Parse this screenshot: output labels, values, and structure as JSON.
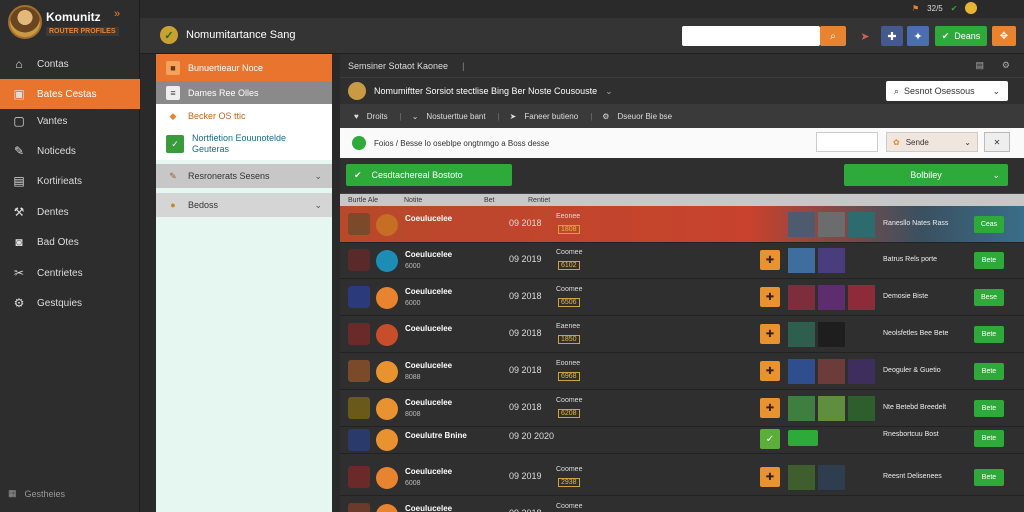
{
  "brand": {
    "name": "Komunitz",
    "sub": "ROUTER PROFILES",
    "mark": "»"
  },
  "top": {
    "title": "Nomumitartance Sang",
    "search_placeholder": "",
    "green_label": "Deans",
    "status": "32/5"
  },
  "nav": {
    "items": [
      {
        "label": "Contas",
        "icon": "home-icon"
      },
      {
        "label": "Bates Cestas",
        "icon": "folder-icon"
      },
      {
        "label": "Vantes",
        "icon": "window-icon"
      },
      {
        "label": "Noticeds",
        "icon": "wrench-icon"
      },
      {
        "label": "Kortirieats",
        "icon": "panel-icon"
      },
      {
        "label": "Dentes",
        "icon": "hammer-icon"
      },
      {
        "label": "Bad Otes",
        "icon": "badge-icon"
      },
      {
        "label": "Centrietes",
        "icon": "tools-icon"
      },
      {
        "label": "Gestquies",
        "icon": "gear-icon"
      }
    ],
    "footer": "Gestheies"
  },
  "categories": [
    {
      "label": "Bunuertieaur Noce"
    },
    {
      "label": "Dames Ree Olles"
    },
    {
      "label": "Becker OS ttic"
    },
    {
      "label": "Nortfietion Eouunotelde",
      "label2": "Geuteras"
    },
    {
      "label": "Resronerats Sesens"
    },
    {
      "label": "Bedoss"
    }
  ],
  "main": {
    "hdr1": "Semsiner Sotaot Kaonee",
    "hdr2": "Nomumiftter Sorsiot stectlise Bing Ber Noste Cousouste",
    "filter_btn": "Sesnot Osessous",
    "subbar": [
      "Droits",
      "Nostuerttue bant",
      "Faneer butieno",
      "Dseuor Bie bse"
    ],
    "crumb": "Foios  /  Besse lo oseblpe ongtnmgo a Boss desse",
    "crumb_btn": "Sende",
    "green_main": "Cesdtachereal Bostoto",
    "green_right": "Bolbiley",
    "cols": [
      "Burtle Ale",
      "Notite",
      "Bet",
      "Rentiet"
    ]
  },
  "rows": [
    {
      "name": "Coeulucelee",
      "sub": "",
      "time": "09 2018",
      "tag": "Eeonee",
      "tag2": "1808",
      "desc": "Ranesllo Nates Rass",
      "btn": "Ceas",
      "highlight": true
    },
    {
      "name": "Coeulucelee",
      "sub": "6000",
      "time": "09 2019",
      "tag": "Coomee",
      "tag2": "6102",
      "desc": "Batrus Rels porte",
      "btn": "Bete"
    },
    {
      "name": "Coeulucelee",
      "sub": "6000",
      "time": "09 2018",
      "tag": "Coomee",
      "tag2": "6506",
      "desc": "Demosie Biste",
      "btn": "Bese"
    },
    {
      "name": "Coeulucelee",
      "sub": "",
      "time": "09 2018",
      "tag": "Eaenee",
      "tag2": "1850",
      "desc": "Neolsfetles Bee Bete",
      "btn": "Bete"
    },
    {
      "name": "Coeulucelee",
      "sub": "8088",
      "time": "09 2018",
      "tag": "Eoonee",
      "tag2": "6968",
      "desc": "Deoguler & Guetio",
      "btn": "Bete"
    },
    {
      "name": "Coeulucelee",
      "sub": "8008",
      "time": "09 2018",
      "tag": "Coomee",
      "tag2": "6208",
      "desc": "Nte Betebd Breedelt",
      "btn": "Bete"
    },
    {
      "name": "Coeulutre Bnine",
      "sub": "",
      "time": "09 20 2020",
      "tag": "",
      "tag2": "",
      "desc": "Rnesbortcuu Bost",
      "btn": "Bete",
      "compact": true
    },
    {
      "name": "Coeulucelee",
      "sub": "6008",
      "time": "09 2019",
      "tag": "Coomee",
      "tag2": "2938",
      "desc": "Reesnt Delisenees",
      "btn": "Bete"
    },
    {
      "name": "Coeulucelee",
      "sub": "",
      "time": "09 2018",
      "tag": "Coomee",
      "tag2": "",
      "desc": "",
      "btn": ""
    }
  ]
}
